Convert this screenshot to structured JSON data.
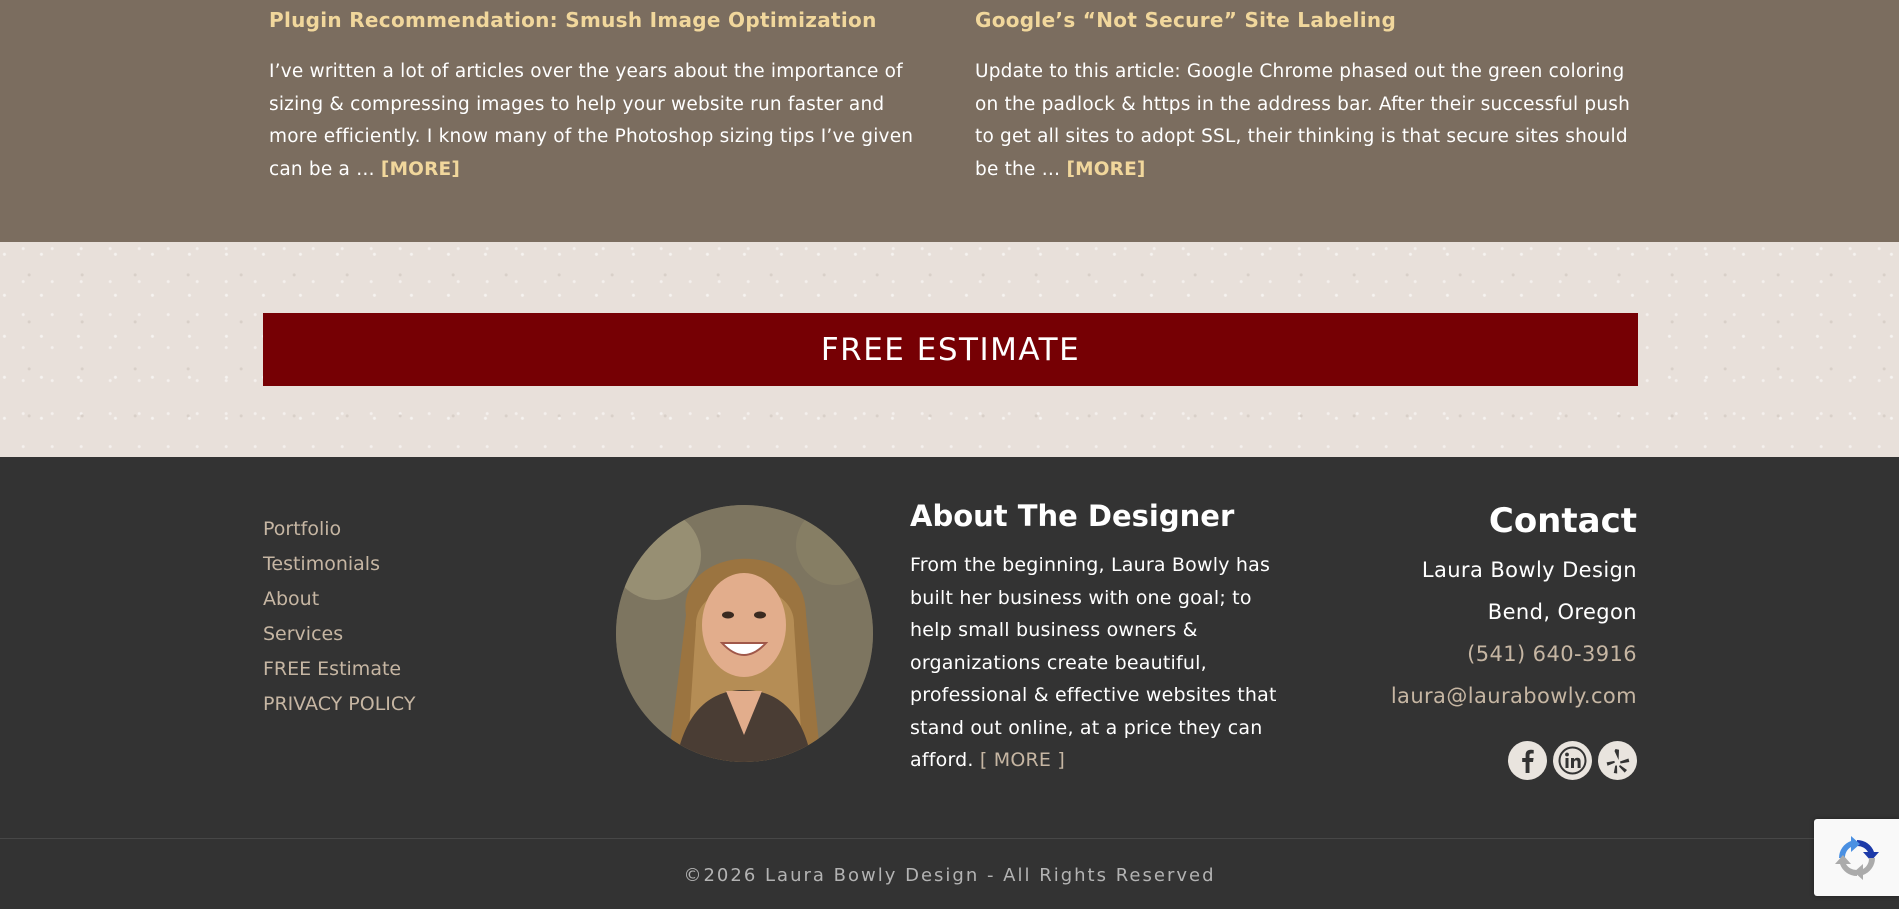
{
  "blog": {
    "posts": [
      {
        "title": "Plugin Recommendation: Smush Image Optimization",
        "excerpt": "  I’ve written a lot of articles over the years about the importance of sizing & compressing images to help your website run faster and more efficiently. I know many of the Photoshop sizing tips I’ve given can be a … ",
        "more_label": "[MORE]"
      },
      {
        "title": "Google’s “Not Secure” Site Labeling",
        "excerpt": "Update to this article: Google Chrome phased out the green coloring on the padlock & https in the address bar. After their successful push to get all sites to adopt SSL, their thinking is that secure sites should be the … ",
        "more_label": "[MORE]"
      }
    ]
  },
  "cta": {
    "label": "FREE ESTIMATE"
  },
  "footer": {
    "nav": [
      "Portfolio",
      "Testimonials",
      "About",
      "Services",
      "FREE Estimate",
      "PRIVACY POLICY"
    ],
    "about": {
      "title": "About The Designer",
      "text": "From the beginning, Laura Bowly has built her business with one goal; to help small business owners & organizations create beautiful, professional & effective websites that stand out online, at a price they can afford. ",
      "more_label": "[ MORE ]"
    },
    "contact": {
      "title": "Contact",
      "company": "Laura Bowly Design",
      "location": "Bend, Oregon",
      "phone": "(541) 640-3916",
      "email": "laura@laurabowly.com"
    },
    "socials": [
      "facebook-icon",
      "linkedin-icon",
      "yelp-icon"
    ],
    "copyright": "©2026 Laura Bowly Design - All Rights Reserved"
  },
  "colors": {
    "blog_bg": "#7b6d5f",
    "accent_gold": "#f1d79c",
    "cta_red": "#760004",
    "footer_bg": "#333333",
    "link_tan": "#c6b6a3"
  }
}
